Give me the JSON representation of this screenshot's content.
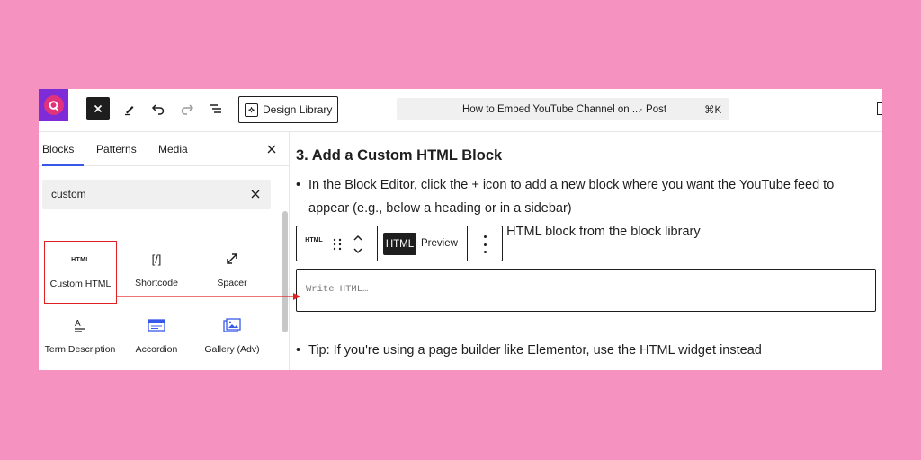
{
  "toolbar": {
    "design_library_label": "Design Library",
    "command_title": "How to Embed YouTube Channel on ...",
    "command_type": "· Post",
    "command_shortcut": "⌘K"
  },
  "sidebar": {
    "tabs": [
      {
        "label": "Blocks"
      },
      {
        "label": "Patterns"
      },
      {
        "label": "Media"
      }
    ],
    "search": {
      "value": "custom"
    },
    "blocks": [
      {
        "icon": "html-icon",
        "icon_text": "HTML",
        "label": "Custom HTML"
      },
      {
        "icon": "shortcode-icon",
        "icon_text": "[/]",
        "label": "Shortcode"
      },
      {
        "icon": "spacer-icon",
        "label": "Spacer"
      },
      {
        "icon": "term-description-icon",
        "label": "Term Description"
      },
      {
        "icon": "accordion-icon",
        "label": "Accordion"
      },
      {
        "icon": "gallery-icon",
        "label": "Gallery (Adv)"
      }
    ]
  },
  "content": {
    "heading": "3. Add a Custom HTML Block",
    "bullet_1": "In the Block Editor, click the + icon to add a new block where you want the YouTube feed to appear (e.g., below a heading or in a sidebar)",
    "bullet_2_visible": "om HTML block from the block library",
    "bullet_3": "Tip: If you're using a page builder like Elementor, use the HTML widget instead",
    "block_toolbar": {
      "type_icon_text": "HTML",
      "html_tab": "HTML",
      "preview_tab": "Preview"
    },
    "html_editor": {
      "placeholder": "Write HTML…"
    }
  },
  "colors": {
    "background": "#f592bf",
    "highlight": "#e02020",
    "accent": "#3858e9"
  }
}
